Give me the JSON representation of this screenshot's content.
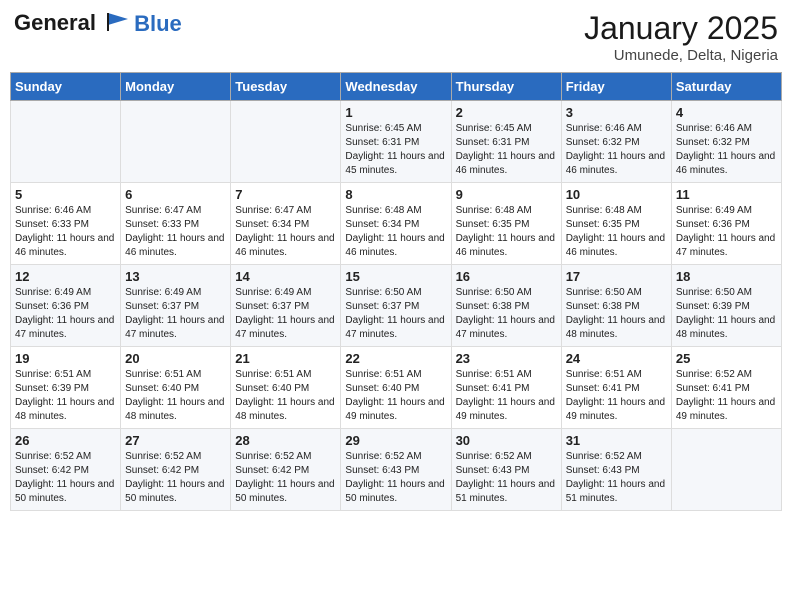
{
  "header": {
    "logo_line1": "General",
    "logo_line2": "Blue",
    "title": "January 2025",
    "subtitle": "Umunede, Delta, Nigeria"
  },
  "days_of_week": [
    "Sunday",
    "Monday",
    "Tuesday",
    "Wednesday",
    "Thursday",
    "Friday",
    "Saturday"
  ],
  "weeks": [
    [
      {
        "day": "",
        "sunrise": "",
        "sunset": "",
        "daylight": ""
      },
      {
        "day": "",
        "sunrise": "",
        "sunset": "",
        "daylight": ""
      },
      {
        "day": "",
        "sunrise": "",
        "sunset": "",
        "daylight": ""
      },
      {
        "day": "1",
        "sunrise": "Sunrise: 6:45 AM",
        "sunset": "Sunset: 6:31 PM",
        "daylight": "Daylight: 11 hours and 45 minutes."
      },
      {
        "day": "2",
        "sunrise": "Sunrise: 6:45 AM",
        "sunset": "Sunset: 6:31 PM",
        "daylight": "Daylight: 11 hours and 46 minutes."
      },
      {
        "day": "3",
        "sunrise": "Sunrise: 6:46 AM",
        "sunset": "Sunset: 6:32 PM",
        "daylight": "Daylight: 11 hours and 46 minutes."
      },
      {
        "day": "4",
        "sunrise": "Sunrise: 6:46 AM",
        "sunset": "Sunset: 6:32 PM",
        "daylight": "Daylight: 11 hours and 46 minutes."
      }
    ],
    [
      {
        "day": "5",
        "sunrise": "Sunrise: 6:46 AM",
        "sunset": "Sunset: 6:33 PM",
        "daylight": "Daylight: 11 hours and 46 minutes."
      },
      {
        "day": "6",
        "sunrise": "Sunrise: 6:47 AM",
        "sunset": "Sunset: 6:33 PM",
        "daylight": "Daylight: 11 hours and 46 minutes."
      },
      {
        "day": "7",
        "sunrise": "Sunrise: 6:47 AM",
        "sunset": "Sunset: 6:34 PM",
        "daylight": "Daylight: 11 hours and 46 minutes."
      },
      {
        "day": "8",
        "sunrise": "Sunrise: 6:48 AM",
        "sunset": "Sunset: 6:34 PM",
        "daylight": "Daylight: 11 hours and 46 minutes."
      },
      {
        "day": "9",
        "sunrise": "Sunrise: 6:48 AM",
        "sunset": "Sunset: 6:35 PM",
        "daylight": "Daylight: 11 hours and 46 minutes."
      },
      {
        "day": "10",
        "sunrise": "Sunrise: 6:48 AM",
        "sunset": "Sunset: 6:35 PM",
        "daylight": "Daylight: 11 hours and 46 minutes."
      },
      {
        "day": "11",
        "sunrise": "Sunrise: 6:49 AM",
        "sunset": "Sunset: 6:36 PM",
        "daylight": "Daylight: 11 hours and 47 minutes."
      }
    ],
    [
      {
        "day": "12",
        "sunrise": "Sunrise: 6:49 AM",
        "sunset": "Sunset: 6:36 PM",
        "daylight": "Daylight: 11 hours and 47 minutes."
      },
      {
        "day": "13",
        "sunrise": "Sunrise: 6:49 AM",
        "sunset": "Sunset: 6:37 PM",
        "daylight": "Daylight: 11 hours and 47 minutes."
      },
      {
        "day": "14",
        "sunrise": "Sunrise: 6:49 AM",
        "sunset": "Sunset: 6:37 PM",
        "daylight": "Daylight: 11 hours and 47 minutes."
      },
      {
        "day": "15",
        "sunrise": "Sunrise: 6:50 AM",
        "sunset": "Sunset: 6:37 PM",
        "daylight": "Daylight: 11 hours and 47 minutes."
      },
      {
        "day": "16",
        "sunrise": "Sunrise: 6:50 AM",
        "sunset": "Sunset: 6:38 PM",
        "daylight": "Daylight: 11 hours and 47 minutes."
      },
      {
        "day": "17",
        "sunrise": "Sunrise: 6:50 AM",
        "sunset": "Sunset: 6:38 PM",
        "daylight": "Daylight: 11 hours and 48 minutes."
      },
      {
        "day": "18",
        "sunrise": "Sunrise: 6:50 AM",
        "sunset": "Sunset: 6:39 PM",
        "daylight": "Daylight: 11 hours and 48 minutes."
      }
    ],
    [
      {
        "day": "19",
        "sunrise": "Sunrise: 6:51 AM",
        "sunset": "Sunset: 6:39 PM",
        "daylight": "Daylight: 11 hours and 48 minutes."
      },
      {
        "day": "20",
        "sunrise": "Sunrise: 6:51 AM",
        "sunset": "Sunset: 6:40 PM",
        "daylight": "Daylight: 11 hours and 48 minutes."
      },
      {
        "day": "21",
        "sunrise": "Sunrise: 6:51 AM",
        "sunset": "Sunset: 6:40 PM",
        "daylight": "Daylight: 11 hours and 48 minutes."
      },
      {
        "day": "22",
        "sunrise": "Sunrise: 6:51 AM",
        "sunset": "Sunset: 6:40 PM",
        "daylight": "Daylight: 11 hours and 49 minutes."
      },
      {
        "day": "23",
        "sunrise": "Sunrise: 6:51 AM",
        "sunset": "Sunset: 6:41 PM",
        "daylight": "Daylight: 11 hours and 49 minutes."
      },
      {
        "day": "24",
        "sunrise": "Sunrise: 6:51 AM",
        "sunset": "Sunset: 6:41 PM",
        "daylight": "Daylight: 11 hours and 49 minutes."
      },
      {
        "day": "25",
        "sunrise": "Sunrise: 6:52 AM",
        "sunset": "Sunset: 6:41 PM",
        "daylight": "Daylight: 11 hours and 49 minutes."
      }
    ],
    [
      {
        "day": "26",
        "sunrise": "Sunrise: 6:52 AM",
        "sunset": "Sunset: 6:42 PM",
        "daylight": "Daylight: 11 hours and 50 minutes."
      },
      {
        "day": "27",
        "sunrise": "Sunrise: 6:52 AM",
        "sunset": "Sunset: 6:42 PM",
        "daylight": "Daylight: 11 hours and 50 minutes."
      },
      {
        "day": "28",
        "sunrise": "Sunrise: 6:52 AM",
        "sunset": "Sunset: 6:42 PM",
        "daylight": "Daylight: 11 hours and 50 minutes."
      },
      {
        "day": "29",
        "sunrise": "Sunrise: 6:52 AM",
        "sunset": "Sunset: 6:43 PM",
        "daylight": "Daylight: 11 hours and 50 minutes."
      },
      {
        "day": "30",
        "sunrise": "Sunrise: 6:52 AM",
        "sunset": "Sunset: 6:43 PM",
        "daylight": "Daylight: 11 hours and 51 minutes."
      },
      {
        "day": "31",
        "sunrise": "Sunrise: 6:52 AM",
        "sunset": "Sunset: 6:43 PM",
        "daylight": "Daylight: 11 hours and 51 minutes."
      },
      {
        "day": "",
        "sunrise": "",
        "sunset": "",
        "daylight": ""
      }
    ]
  ]
}
